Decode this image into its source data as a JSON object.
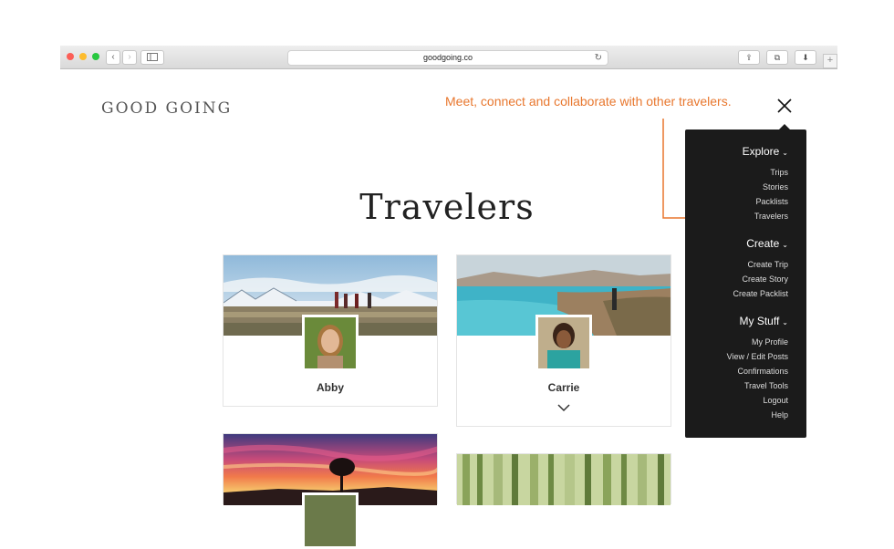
{
  "browser": {
    "url": "goodgoing.co",
    "back_glyph": "‹",
    "forward_glyph": "›",
    "reload_glyph": "↻",
    "share_glyph": "⇪",
    "tabs_glyph": "⧉",
    "download_glyph": "⬇",
    "new_tab_glyph": "+"
  },
  "site": {
    "logo": "GOOD GOING",
    "annotation": "Meet, connect and collaborate with other travelers.",
    "page_title": "Travelers"
  },
  "cards": [
    {
      "name": "Abby"
    },
    {
      "name": "Carrie"
    }
  ],
  "menu": {
    "sections": [
      {
        "label": "Explore",
        "items": [
          "Trips",
          "Stories",
          "Packlists",
          "Travelers"
        ]
      },
      {
        "label": "Create",
        "items": [
          "Create Trip",
          "Create Story",
          "Create Packlist"
        ]
      },
      {
        "label": "My Stuff",
        "items": [
          "My Profile",
          "View / Edit Posts",
          "Confirmations",
          "Travel Tools",
          "Logout",
          "Help"
        ]
      }
    ],
    "caret": "⌄"
  },
  "colors": {
    "annotation": "#e8772e",
    "menu_bg": "#1b1b1b"
  }
}
